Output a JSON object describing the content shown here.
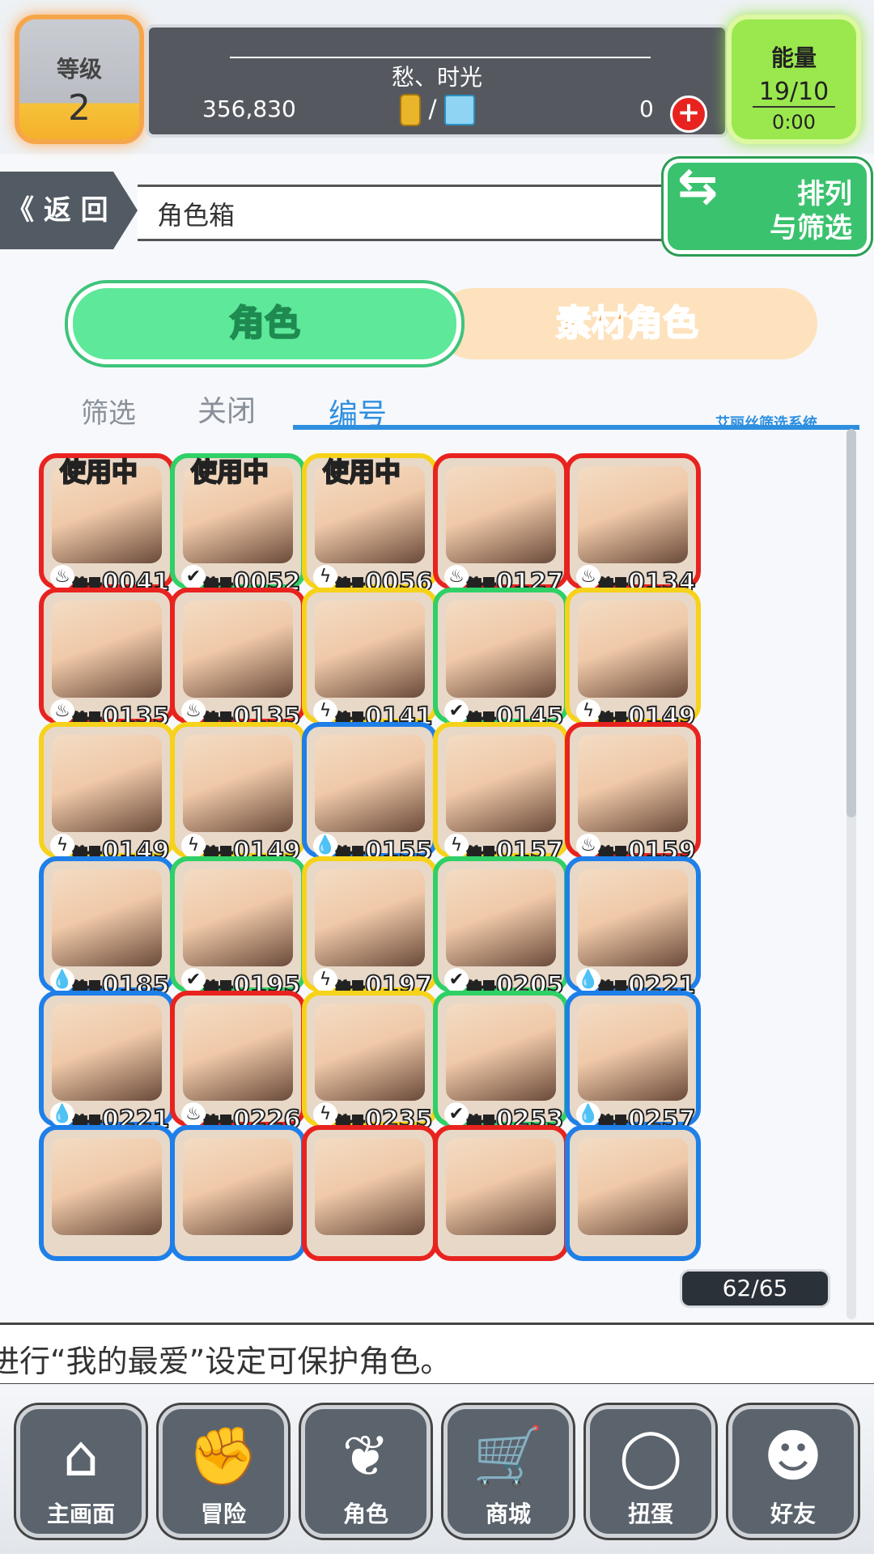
{
  "header": {
    "level_label": "等级",
    "level_value": "2",
    "player_name": "愁、时光",
    "coins": "356,830",
    "currency_separator": "/",
    "gems": "0",
    "plus": "+",
    "energy_label": "能量",
    "energy_value": "19/10",
    "energy_timer": "0:00"
  },
  "nav": {
    "back_label": "返 回",
    "back_chevron": "《",
    "page_title": "角色箱",
    "sort_label_1": "排列",
    "sort_label_2": "与筛选"
  },
  "tabs": {
    "role": "角色",
    "material": "素材角色"
  },
  "filter": {
    "filter_label": "筛选",
    "close_label": "关闭",
    "number_label": "编号",
    "system_label": "艾丽丝筛选系统"
  },
  "card_prefix": "编号",
  "in_use_label": "使用中",
  "colors": {
    "fire": "#e8231f",
    "wood": "#2fd066",
    "thunder": "#f6d21a",
    "water": "#1f7fe8"
  },
  "cards": [
    {
      "num": "0041",
      "element": "fire",
      "in_use": true,
      "stars": "★★"
    },
    {
      "num": "0052",
      "element": "wood",
      "in_use": true,
      "stars": "★★★"
    },
    {
      "num": "0056",
      "element": "thunder",
      "in_use": true,
      "stars": "★★★"
    },
    {
      "num": "0127",
      "element": "fire",
      "in_use": false,
      "stars": "★★★★"
    },
    {
      "num": "0134",
      "element": "fire",
      "in_use": false,
      "stars": "★★★"
    },
    {
      "num": "0135",
      "element": "fire",
      "in_use": false,
      "stars": "★★★"
    },
    {
      "num": "0135",
      "element": "fire",
      "in_use": false,
      "stars": "★★★"
    },
    {
      "num": "0141",
      "element": "thunder",
      "in_use": false,
      "stars": "★★★★"
    },
    {
      "num": "0145",
      "element": "wood",
      "in_use": false,
      "stars": "★★★★"
    },
    {
      "num": "0149",
      "element": "thunder",
      "in_use": false,
      "stars": "★★★★"
    },
    {
      "num": "0149",
      "element": "thunder",
      "in_use": false,
      "stars": "★★★★"
    },
    {
      "num": "0149",
      "element": "thunder",
      "in_use": false,
      "stars": "★★★★"
    },
    {
      "num": "0155",
      "element": "water",
      "in_use": false,
      "stars": "★★★★"
    },
    {
      "num": "0157",
      "element": "thunder",
      "in_use": false,
      "stars": "★★★★"
    },
    {
      "num": "0159",
      "element": "fire",
      "in_use": false,
      "stars": "★★★★"
    },
    {
      "num": "0185",
      "element": "water",
      "in_use": false,
      "stars": "★★★★"
    },
    {
      "num": "0195",
      "element": "wood",
      "in_use": false,
      "stars": "★★★★"
    },
    {
      "num": "0197",
      "element": "thunder",
      "in_use": false,
      "stars": "★★★★"
    },
    {
      "num": "0205",
      "element": "wood",
      "in_use": false,
      "stars": "★★★"
    },
    {
      "num": "0221",
      "element": "water",
      "in_use": false,
      "stars": "★★★★"
    },
    {
      "num": "0221",
      "element": "water",
      "in_use": false,
      "stars": "★★★★"
    },
    {
      "num": "0226",
      "element": "fire",
      "in_use": false,
      "stars": "★★★"
    },
    {
      "num": "0235",
      "element": "thunder",
      "in_use": false,
      "stars": "★★★"
    },
    {
      "num": "0253",
      "element": "wood",
      "in_use": false,
      "stars": "★★★★"
    },
    {
      "num": "0257",
      "element": "water",
      "in_use": false,
      "stars": "★★★★"
    }
  ],
  "partial_cards": [
    "water",
    "water",
    "fire",
    "fire",
    "water"
  ],
  "count_badge": "62/65",
  "tip": "进行“我的最爱”设定可保护角色。",
  "bottom_nav": [
    {
      "label": "主画面",
      "icon": "home-icon"
    },
    {
      "label": "冒险",
      "icon": "handshake-icon"
    },
    {
      "label": "角色",
      "icon": "rabbit-icon"
    },
    {
      "label": "商城",
      "icon": "cart-icon"
    },
    {
      "label": "扭蛋",
      "icon": "egg-icon"
    },
    {
      "label": "好友",
      "icon": "friends-icon"
    }
  ]
}
